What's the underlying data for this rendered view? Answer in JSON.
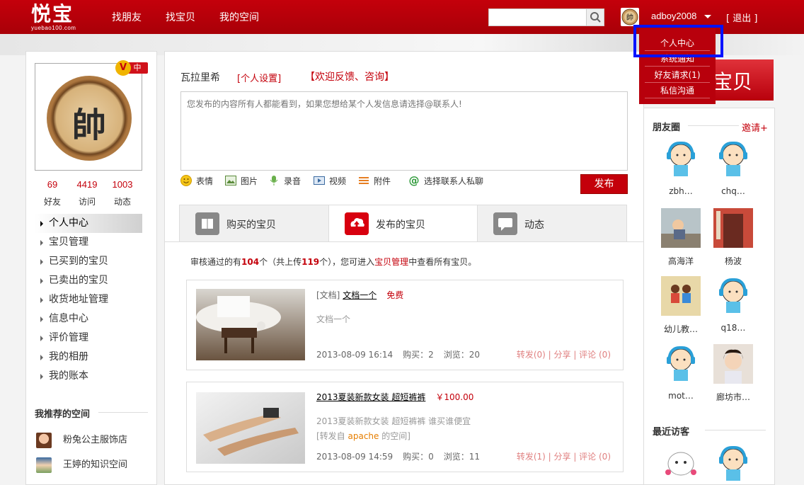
{
  "header": {
    "logo_cn": "悦宝",
    "logo_en": "yuebao100.com",
    "nav": [
      "找朋友",
      "找宝贝",
      "我的空间"
    ],
    "search_placeholder": "",
    "username": "adboy2008",
    "logout": "[ 退出 ]"
  },
  "dropdown": {
    "items": [
      "个人中心",
      "系统通知",
      "好友请求(1)",
      "私信沟通"
    ]
  },
  "profile": {
    "vip_badge": "V",
    "level": "中",
    "avatar_char": "帥",
    "stats": [
      {
        "num": "69",
        "label": "好友"
      },
      {
        "num": "4419",
        "label": "访问"
      },
      {
        "num": "1003",
        "label": "动态"
      }
    ],
    "menu": [
      "个人中心",
      "宝贝管理",
      "已买到的宝贝",
      "已卖出的宝贝",
      "收货地址管理",
      "信息中心",
      "评价管理",
      "我的相册",
      "我的账本"
    ],
    "recommended_title": "我推荐的空间",
    "recommended": [
      "粉兔公主服饰店",
      "王婷的知识空间"
    ]
  },
  "composer": {
    "name": "瓦拉里希",
    "settings": "[个人设置]",
    "feedback": "【欢迎反馈、咨询】",
    "placeholder": "您发布的内容所有人都能看到，如果您想给某个人发信息请选择@联系人!",
    "tools": [
      "表情",
      "图片",
      "录音",
      "视频",
      "附件",
      "选择联系人私聊"
    ],
    "publish": "发布"
  },
  "tabs": [
    "购买的宝贝",
    "发布的宝贝",
    "动态"
  ],
  "notice": {
    "prefix": "审核通过的有",
    "count": "104",
    "mid1": "个（共上传",
    "total": "119",
    "mid2": "个），您可进入",
    "link": "宝贝管理",
    "suffix": "中查看所有宝贝。"
  },
  "items": [
    {
      "type": "[文档]",
      "title": "文档一个",
      "price": "免费",
      "desc": "文档一个",
      "from_prefix": "",
      "from_user": "",
      "from_suffix": "",
      "date": "2013-08-09 16:14",
      "bought": "购买：2",
      "views": "浏览：20",
      "actions": "转发(0) | 分享 | 评论 (0)"
    },
    {
      "type": "",
      "title": "2013夏装新款女装 超短裤裤",
      "price": "￥100.00",
      "desc": "2013夏装新款女装 超短裤裤 谁买谁便宜",
      "from_prefix": "[转发自 ",
      "from_user": "apache",
      "from_suffix": " 的空间]",
      "date": "2013-08-09 14:59",
      "bought": "购买：0",
      "views": "浏览：11",
      "actions": "转发(1) | 分享 | 评论 (0)"
    }
  ],
  "right": {
    "banner_text": "宝贝",
    "friends_title": "朋友圈",
    "invite": "邀请+",
    "friends": [
      "zbh…",
      "chq…",
      "高海洋",
      "杨波",
      "幼儿教…",
      "q18…",
      "mot…",
      "廊坊市…"
    ],
    "visitors_title": "最近访客"
  },
  "colors": {
    "brand_red": "#c4000b",
    "highlight_blue": "#0012ff"
  }
}
